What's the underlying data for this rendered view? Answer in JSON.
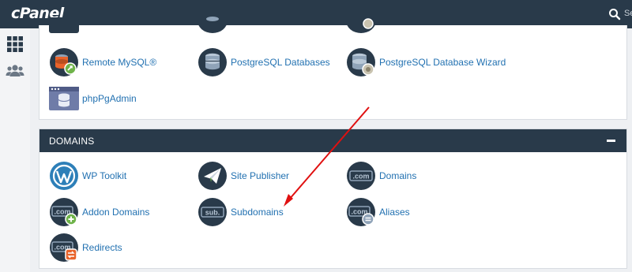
{
  "header": {
    "logo": "cPanel",
    "search_label": "Se"
  },
  "sidebar": {
    "items": [
      {
        "icon": "grid-icon"
      },
      {
        "icon": "users-icon"
      }
    ]
  },
  "databases": {
    "items": [
      {
        "label": "Remote MySQL®"
      },
      {
        "label": "PostgreSQL Databases"
      },
      {
        "label": "PostgreSQL Database Wizard"
      },
      {
        "label": "phpPgAdmin"
      }
    ]
  },
  "domains": {
    "title": "DOMAINS",
    "items": [
      {
        "label": "WP Toolkit"
      },
      {
        "label": "Site Publisher"
      },
      {
        "label": "Domains",
        "icon_text": ".com"
      },
      {
        "label": "Addon Domains",
        "icon_text": ".com"
      },
      {
        "label": "Subdomains",
        "icon_text": "sub."
      },
      {
        "label": "Aliases",
        "icon_text": ".com"
      },
      {
        "label": "Redirects",
        "icon_text": ".com"
      }
    ]
  },
  "colors": {
    "header": "#293a4a",
    "link": "#2271b1",
    "arrow": "#e01010",
    "green": "#6fb34a",
    "orange": "#e8632b"
  }
}
